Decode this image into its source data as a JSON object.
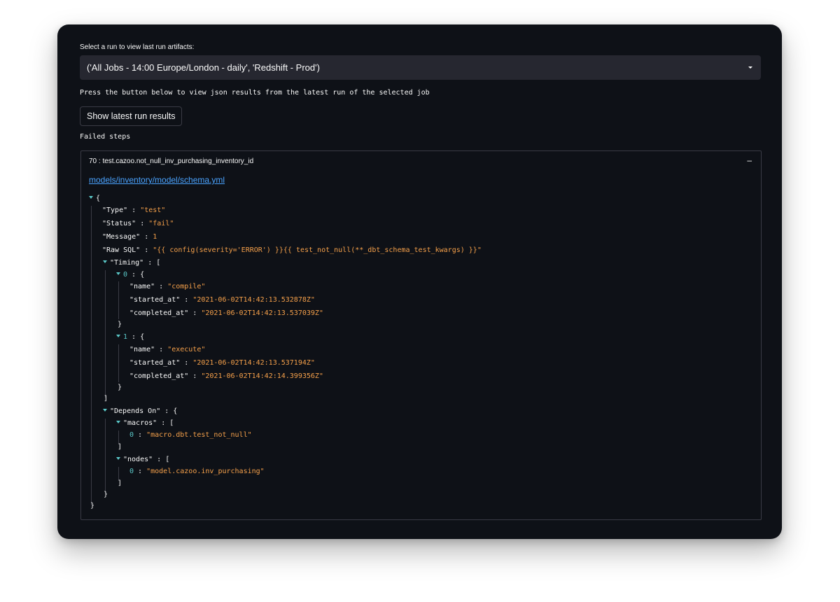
{
  "select": {
    "label": "Select a run to view last run artifacts:",
    "value": "('All Jobs - 14:00 Europe/London - daily', 'Redshift - Prod')"
  },
  "instructions": "Press the button below to view json results from the latest run of the selected job",
  "show_button": "Show latest run results",
  "failed_steps_label": "Failed steps",
  "expander": {
    "title": "70 : test.cazoo.not_null_inv_purchasing_inventory_id",
    "toggle": "–",
    "link": "models/inventory/model/schema.yml"
  },
  "json": {
    "open_brace": "{",
    "close_brace": "}",
    "type": {
      "key": "\"Type\"",
      "value": "\"test\""
    },
    "status": {
      "key": "\"Status\"",
      "value": "\"fail\""
    },
    "message": {
      "key": "\"Message\"",
      "value": "1"
    },
    "raw_sql": {
      "key": "\"Raw SQL\"",
      "value": "\"{{ config(severity='ERROR') }}{{ test_not_null(**_dbt_schema_test_kwargs) }}\""
    },
    "timing": {
      "key": "\"Timing\"",
      "items": [
        {
          "index": "0",
          "name": "\"compile\"",
          "started_at": "\"2021-06-02T14:42:13.532878Z\"",
          "completed_at": "\"2021-06-02T14:42:13.537039Z\""
        },
        {
          "index": "1",
          "name": "\"execute\"",
          "started_at": "\"2021-06-02T14:42:13.537194Z\"",
          "completed_at": "\"2021-06-02T14:42:14.399356Z\""
        }
      ]
    },
    "field_keys": {
      "name": "\"name\"",
      "started_at": "\"started_at\"",
      "completed_at": "\"completed_at\""
    },
    "depends_on": {
      "key": "\"Depends On\"",
      "macros_key": "\"macros\"",
      "macros": [
        {
          "index": "0",
          "value": "\"macro.dbt.test_not_null\""
        }
      ],
      "nodes_key": "\"nodes\"",
      "nodes": [
        {
          "index": "0",
          "value": "\"model.cazoo.inv_purchasing\""
        }
      ]
    }
  }
}
